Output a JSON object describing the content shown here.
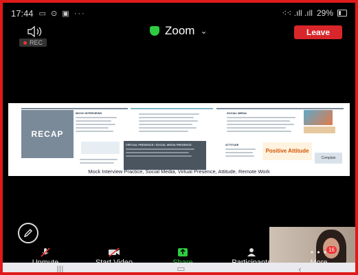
{
  "status_bar": {
    "time": "17:44",
    "signal_text": "⁖⁖ .ıll .ıll",
    "battery": "29%"
  },
  "meeting": {
    "title": "Zoom",
    "leave_label": "Leave",
    "rec_label": "REC"
  },
  "shared_screen": {
    "recap_label": "RECAP",
    "headings": [
      "MOCK INTERVIEWS",
      "SOCIAL MEDIA",
      "VIRTUAL PRESENCE / SOCIAL MEDIA PRESENCE",
      "ATTITUDE"
    ],
    "caption": "Mock Interview Practice, Social Media, Virtual Presence, Attitude, Remote Work",
    "attitude_image_text": "Positive Attitude",
    "attitude_pic_text": "Complain"
  },
  "toolbar": {
    "unmute": "Unmute",
    "start_video": "Start Video",
    "share": "Share",
    "participants": "Participants",
    "more": "More",
    "more_badge": "16"
  },
  "colors": {
    "leave": "#d9262a",
    "share": "#2ecc40",
    "frame": "#e01a1a"
  }
}
